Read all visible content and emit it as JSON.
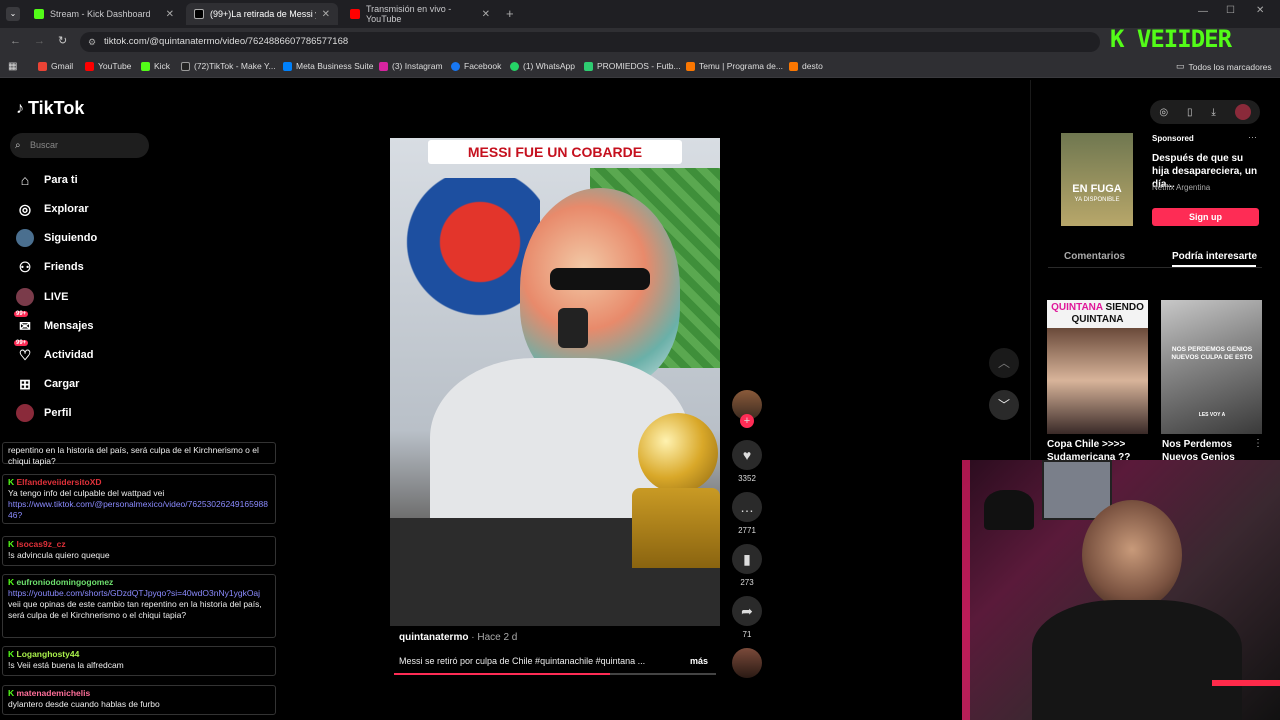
{
  "browser": {
    "tabs": [
      {
        "label": "Stream - Kick Dashboard",
        "color": "#53fc18"
      },
      {
        "label": "(99+)La retirada de Messi y su",
        "color": "#ffffff"
      },
      {
        "label": "Transmisión en vivo - YouTube",
        "color": "#ff0000"
      }
    ],
    "url": "tiktok.com/@quintanatermo/video/7624886607786577168",
    "bookmarks": [
      "Gmail",
      "YouTube",
      "Kick",
      "(72)TikTok - Make Y...",
      "Meta Business Suite",
      "(3) Instagram",
      "Facebook",
      "(1) WhatsApp",
      "PROMIEDOS - Futb...",
      "Temu | Programa de...",
      "desto"
    ],
    "all_bookmarks": "Todos los marcadores"
  },
  "sidebar": {
    "logo": "TikTok",
    "search_placeholder": "Buscar",
    "items": [
      {
        "label": "Para ti",
        "icon": "home-icon"
      },
      {
        "label": "Explorar",
        "icon": "compass-icon"
      },
      {
        "label": "Siguiendo",
        "icon": "following-avatar-icon"
      },
      {
        "label": "Friends",
        "icon": "friends-icon"
      },
      {
        "label": "LIVE",
        "icon": "live-icon"
      },
      {
        "label": "Mensajes",
        "icon": "messages-icon",
        "badge": "99+"
      },
      {
        "label": "Actividad",
        "icon": "activity-icon",
        "badge": "99+"
      },
      {
        "label": "Cargar",
        "icon": "upload-icon"
      },
      {
        "label": "Perfil",
        "icon": "profile-icon"
      }
    ]
  },
  "chat": [
    {
      "user": "",
      "text": "repentino en la historia del país, será culpa de el Kirchnerismo o el chiqui tapia?"
    },
    {
      "user": "ElfandeveiidersitoXD",
      "text": "Ya tengo info del culpable del wattpad vei",
      "link": "https://www.tiktok.com/@personalmexico/video/7625302624916598846?"
    },
    {
      "user": "Isocas9z_cz",
      "text": "!s advincula quiero queque"
    },
    {
      "user": "eufroniodomingogomez",
      "link": "https://youtube.com/shorts/GDzdQTJpyqo?si=40wdO3nNy1ygkOaj",
      "text": "veii que opinas de este cambio tan repentino en la historia del país, será culpa de el Kirchnerismo o el chiqui tapia?"
    },
    {
      "user": "Loganghosty44",
      "text": "!s Veii está buena la alfredcam"
    },
    {
      "user": "matenademichelis",
      "text": "dylantero desde cuando hablas de furbo"
    }
  ],
  "video": {
    "title_overlay": "MESSI FUE UN COBARDE",
    "author": "quintanatermo",
    "posted": "· Hace 2 d",
    "description": "Messi se retiró por culpa de Chile #quintanachile #quintana ...",
    "more": "más",
    "likes": "3352",
    "comments": "2771",
    "saves": "273",
    "shares": "71",
    "progress": 0.67
  },
  "right_panel": {
    "sponsored": "Sponsored",
    "ad_title": "Después de que su hija desapareciera, un día...",
    "ad_source": "Netflix Argentina",
    "ad_image_text": "EN FUGA",
    "ad_image_sub": "YA DISPONIBLE",
    "signup": "Sign up",
    "tab_comments": "Comentarios",
    "tab_interest": "Podría interesarte",
    "thumbs": [
      {
        "title": "Copa Chile >>>> Sudamericana ??",
        "overlay_a": "QUINTANA",
        "overlay_b": "SIENDO QUINTANA"
      },
      {
        "title": "Nos Perdemos Nuevos Genios",
        "overlay": "NOS PERDEMOS GENIOS NUEVOS CULPA DE ESTO",
        "overlay_sub": "LES VOY A"
      }
    ]
  },
  "kick_banner": "K VEIIDER",
  "colors": {
    "accent": "#fe2c55",
    "kick": "#53fc18"
  }
}
